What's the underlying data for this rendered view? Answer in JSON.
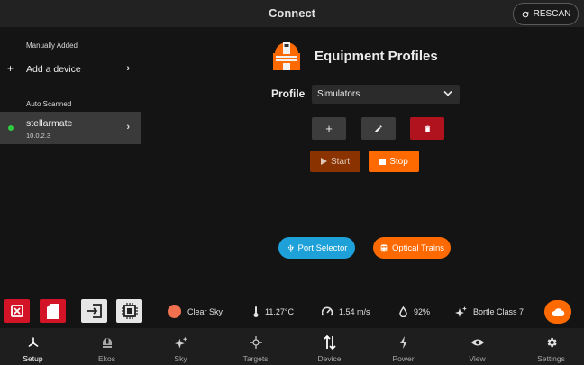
{
  "header": {
    "title": "Connect",
    "rescan_label": "RESCAN"
  },
  "sidebar": {
    "manual_label": "Manually Added",
    "add_device_label": "Add a device",
    "auto_label": "Auto Scanned",
    "device": {
      "name": "stellarmate",
      "ip": "10.0.2.3",
      "status_color": "#2ecc40"
    }
  },
  "main": {
    "title": "Equipment Profiles",
    "profile_label": "Profile",
    "profile_value": "Simulators",
    "add_symbol": "+",
    "start_label": "Start",
    "stop_label": "Stop",
    "port_selector_label": "Port Selector",
    "optical_trains_label": "Optical Trains"
  },
  "status": {
    "sky": "Clear Sky",
    "temperature": "11.27°C",
    "wind": "1.54 m/s",
    "humidity": "92%",
    "bortle": "Bortle Class 7"
  },
  "nav": {
    "items": [
      {
        "label": "Setup",
        "icon": "setup-icon"
      },
      {
        "label": "Ekos",
        "icon": "ekos-icon"
      },
      {
        "label": "Sky",
        "icon": "sky-icon"
      },
      {
        "label": "Targets",
        "icon": "targets-icon"
      },
      {
        "label": "Device",
        "icon": "device-icon"
      },
      {
        "label": "Power",
        "icon": "power-icon"
      },
      {
        "label": "View",
        "icon": "view-icon"
      },
      {
        "label": "Settings",
        "icon": "settings-icon"
      }
    ],
    "active": "Setup"
  },
  "colors": {
    "accent": "#ff6a00",
    "danger": "#d31427",
    "blue": "#1ea0d8",
    "sky_indicator": "#f07050"
  }
}
